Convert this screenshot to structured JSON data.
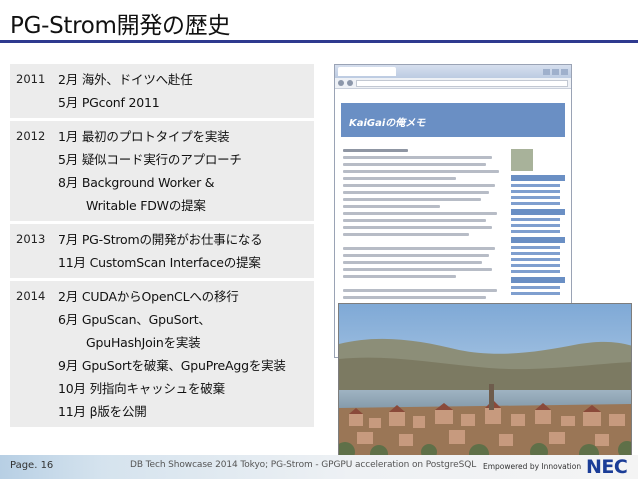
{
  "slide": {
    "title": "PG-Strom開発の歴史"
  },
  "timeline": [
    {
      "year": "2011",
      "events": [
        {
          "text": "2月 海外、ドイツへ赴任",
          "indent": false
        },
        {
          "text": "5月 PGconf 2011",
          "indent": false
        }
      ]
    },
    {
      "year": "2012",
      "events": [
        {
          "text": "1月 最初のプロトタイプを実装",
          "indent": false
        },
        {
          "text": "5月 疑似コード実行のアプローチ",
          "indent": false
        },
        {
          "text": "8月 Background Worker &",
          "indent": false
        },
        {
          "text": "Writable FDWの提案",
          "indent": true
        }
      ]
    },
    {
      "year": "2013",
      "events": [
        {
          "text": "7月 PG-Stromの開発がお仕事になる",
          "indent": false
        },
        {
          "text": "11月 CustomScan Interfaceの提案",
          "indent": false
        }
      ]
    },
    {
      "year": "2014",
      "events": [
        {
          "text": "2月 CUDAからOpenCLへの移行",
          "indent": false
        },
        {
          "text": "6月 GpuScan、GpuSort、",
          "indent": false
        },
        {
          "text": "GpuHashJoinを実装",
          "indent": true
        },
        {
          "text": "9月 GpuSortを破棄、GpuPreAggを実装",
          "indent": false
        },
        {
          "text": "10月 列指向キャッシュを破棄",
          "indent": false
        },
        {
          "text": "11月 β版を公開",
          "indent": false
        }
      ]
    }
  ],
  "screenshot": {
    "blog_name": "KaiGaiの俺メモ"
  },
  "footer": {
    "page": "Page. 16",
    "title": "DB Tech Showcase 2014 Tokyo; PG-Strom - GPGPU acceleration on PostgreSQL",
    "tagline": "Empowered by Innovation",
    "logo": "NEC"
  },
  "colors": {
    "title_rule": "#2f3a8f",
    "row_background": "#ececec",
    "blog_header": "#6a8fc4",
    "nec_blue": "#1b3d97"
  }
}
